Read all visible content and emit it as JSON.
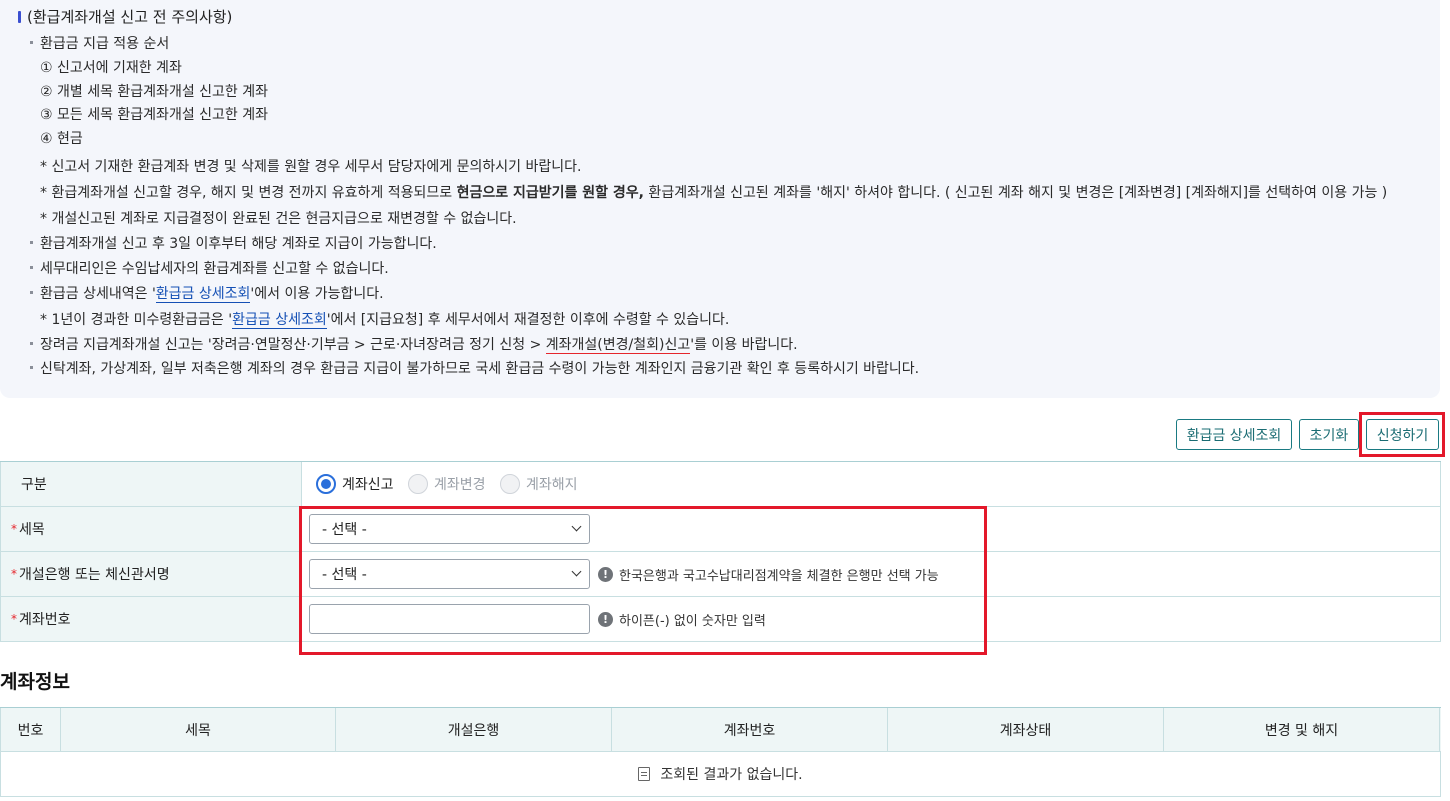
{
  "notice": {
    "title": "(환급계좌개설 신고 전 주의사항)",
    "order_title": "환급금 지급 적용 순서",
    "order_items": [
      "① 신고서에 기재한 계좌",
      "② 개별 세목 환급계좌개설 신고한 계좌",
      "③ 모든 세목 환급계좌개설 신고한 계좌",
      "④ 현금"
    ],
    "note1": "* 신고서 기재한 환급계좌 변경 및 삭제를 원할 경우 세무서 담당자에게 문의하시기 바랍니다.",
    "note2_a": "* 환급계좌개설 신고할 경우, 해지 및 변경 전까지 유효하게 적용되므로 ",
    "note2_b": "현금으로 지급받기를 원할 경우,",
    "note2_c": " 환급계좌개설 신고된 계좌를 '해지' 하셔야 합니다. ( 신고된 계좌 해지 및 변경은 [계좌변경] [계좌해지]를 선택하여 이용 가능 )",
    "note3": "* 개설신고된 계좌로 지급결정이 완료된 건은 현금지급으로 재변경할 수 없습니다.",
    "b2": "환급계좌개설 신고 후 3일 이후부터 해당 계좌로 지급이 가능합니다.",
    "b3": "세무대리인은 수임납세자의 환급계좌를 신고할 수 없습니다.",
    "b4_a": "환급금 상세내역은 '",
    "b4_link": "환급금 상세조회",
    "b4_b": "'에서 이용 가능합니다.",
    "b4_sub_a": "* 1년이 경과한 미수령환급금은 '",
    "b4_sub_link": "환급금 상세조회",
    "b4_sub_b": "'에서 [지급요청] 후 세무서에서 재결정한 이후에 수령할 수 있습니다.",
    "b5_a": "장려금 지급계좌개설 신고는 '장려금·연말정산·기부금 > 근로·자녀장려금 정기 신청 > ",
    "b5_link": "계좌개설(변경/철회)신고",
    "b5_b": "'를 이용 바랍니다.",
    "b6": "신탁계좌, 가상계좌, 일부 저축은행 계좌의 경우 환급금 지급이 불가하므로 국세 환급금 수령이 가능한 계좌인지 금융기관 확인 후 등록하시기 바랍니다."
  },
  "buttons": {
    "detail": "환급금 상세조회",
    "reset": "초기화",
    "apply": "신청하기"
  },
  "form": {
    "type_label": "구분",
    "radios": [
      {
        "label": "계좌신고",
        "checked": true
      },
      {
        "label": "계좌변경",
        "checked": false
      },
      {
        "label": "계좌해지",
        "checked": false
      }
    ],
    "tax_label": "세목",
    "tax_value": "- 선택 -",
    "bank_label": "개설은행 또는 체신관서명",
    "bank_value": "- 선택 -",
    "bank_hint": "한국은행과 국고수납대리점계약을 체결한 은행만 선택 가능",
    "account_label": "계좌번호",
    "account_value": "",
    "account_hint": "하이픈(-) 없이 숫자만 입력",
    "required_mark": "*",
    "hint_icon": "!"
  },
  "account_info": {
    "title": "계좌정보",
    "columns": [
      "번호",
      "세목",
      "개설은행",
      "계좌번호",
      "계좌상태",
      "변경 및 해지"
    ],
    "empty_text": "조회된 결과가 없습니다."
  },
  "colors": {
    "accent": "#1a7a82",
    "highlight": "#e3182a",
    "warning_text": "#e5262c",
    "link": "#1550b5"
  }
}
